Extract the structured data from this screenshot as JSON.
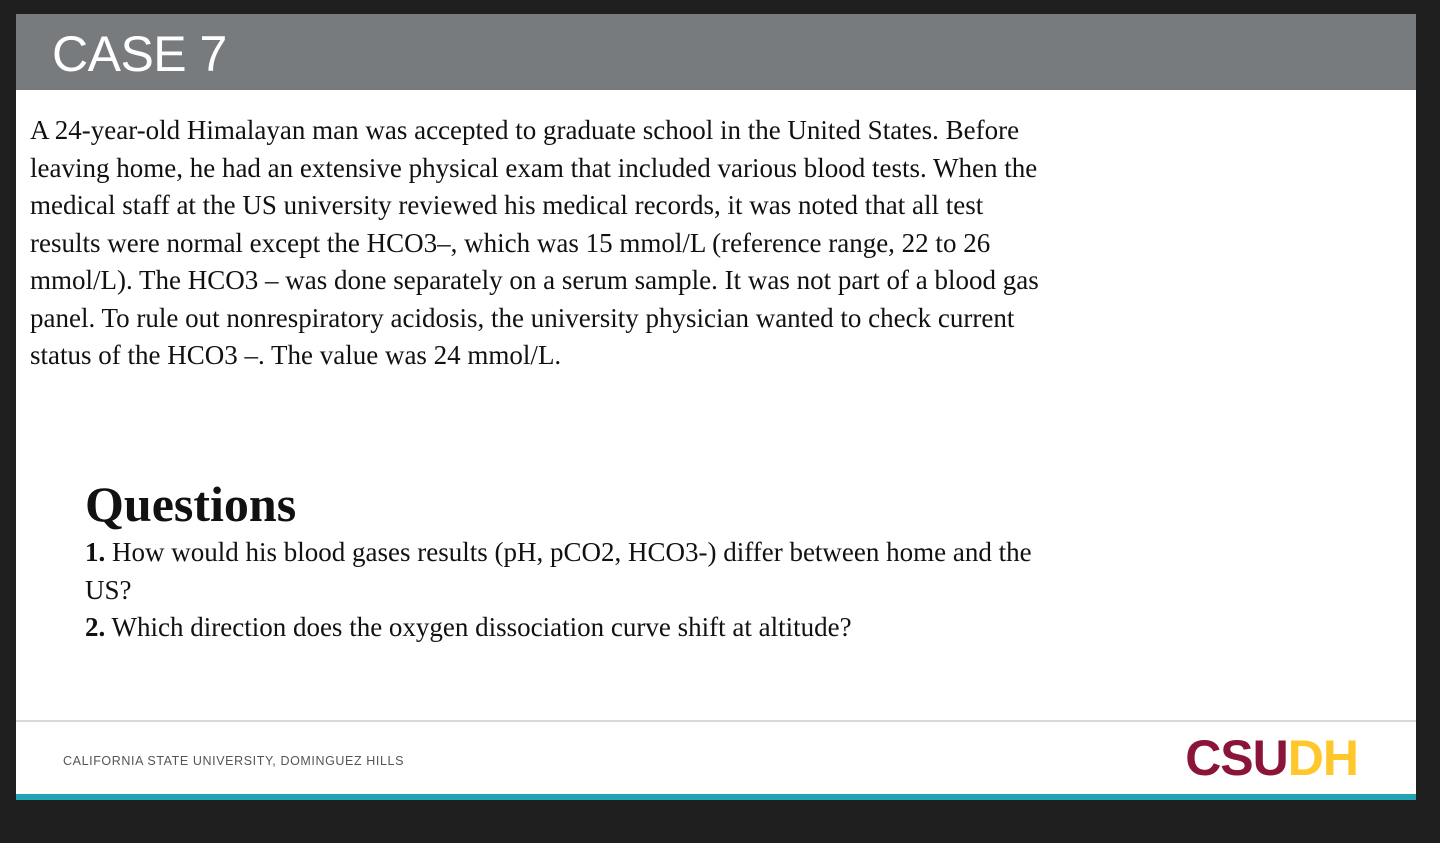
{
  "slide": {
    "title": "CASE 7",
    "case_lines": [
      "A 24-year-old Himalayan man was accepted to graduate school in the United States. Before",
      "leaving home, he had an extensive physical exam that included various blood tests. When the",
      "medical staff at the US university reviewed his medical records, it was noted that all test",
      "results were normal except the HCO3–, which was 15 mmol/L (reference range, 22 to 26",
      "mmol/L). The HCO3 – was done separately on a serum sample. It was not part of a blood gas",
      "panel. To rule out nonrespiratory acidosis, the university physician wanted to check current",
      "status of the HCO3 –. The value was 24 mmol/L."
    ],
    "questions_heading": "Questions",
    "questions": [
      {
        "num": "1.",
        "text": "How would his blood gases results (pH, pCO2, HCO3-) differ between home and the",
        "cont": "US?"
      },
      {
        "num": "2.",
        "text": "Which direction does the oxygen dissociation curve shift at altitude?"
      }
    ]
  },
  "footer": {
    "institution": "CALIFORNIA STATE UNIVERSITY, DOMINGUEZ HILLS",
    "logo_part1": "CSU",
    "logo_part2": "DH",
    "logo_color1": "#8a1538",
    "logo_color2": "#ffc72c",
    "accent_bar_color": "#21a5b5"
  }
}
